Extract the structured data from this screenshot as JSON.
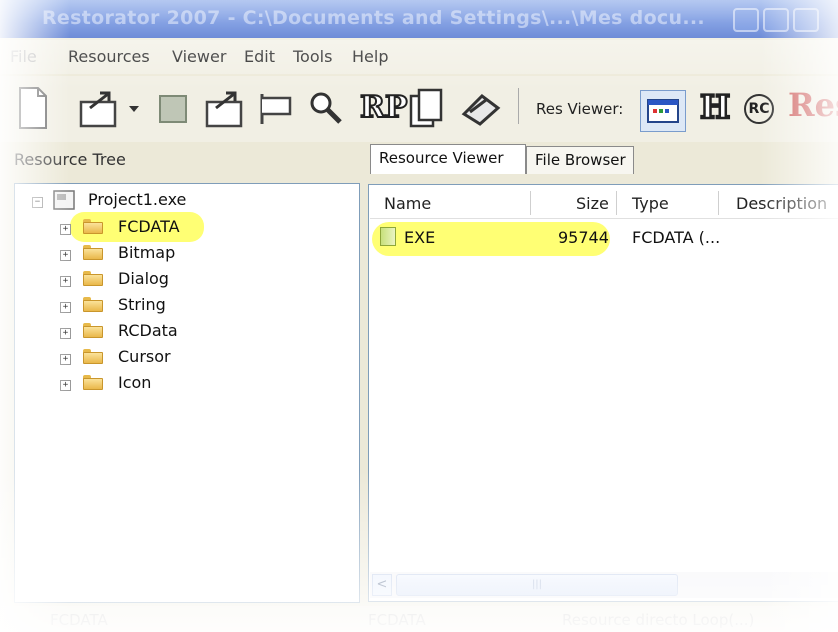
{
  "window": {
    "title": "Restorator 2007 - C:\\Documents and Settings\\...\\Mes docu..."
  },
  "menu": [
    "File",
    "Resources",
    "Viewer",
    "Edit",
    "Tools",
    "Help"
  ],
  "toolbar": {
    "res_viewer_label": "Res Viewer:",
    "rp_label": "RP",
    "h_label": "H",
    "rc_label": "RC",
    "res_label": "Res"
  },
  "resource_tree": {
    "title": "Resource Tree",
    "root": "Project1.exe",
    "items": [
      {
        "label": "FCDATA",
        "highlighted": true
      },
      {
        "label": "Bitmap"
      },
      {
        "label": "Dialog"
      },
      {
        "label": "String"
      },
      {
        "label": "RCData"
      },
      {
        "label": "Cursor"
      },
      {
        "label": "Icon"
      }
    ]
  },
  "tabs": [
    {
      "label": "Resource Viewer",
      "active": true
    },
    {
      "label": "File Browser",
      "active": false
    }
  ],
  "list": {
    "columns": [
      "Name",
      "Size",
      "Type",
      "Description"
    ],
    "rows": [
      {
        "name": "EXE",
        "size": "95744",
        "type": "FCDATA (..."
      }
    ]
  },
  "scrollbar": {
    "thumb_glyph": "|||"
  },
  "status": {
    "cell1": "FCDATA",
    "cell2": "FCDATA",
    "cell3": "Resource directo Loop(...)"
  },
  "colors": {
    "highlight": "#ffff5c",
    "titlebar": "#2f5fd0",
    "folder": "#f5cf6a"
  }
}
